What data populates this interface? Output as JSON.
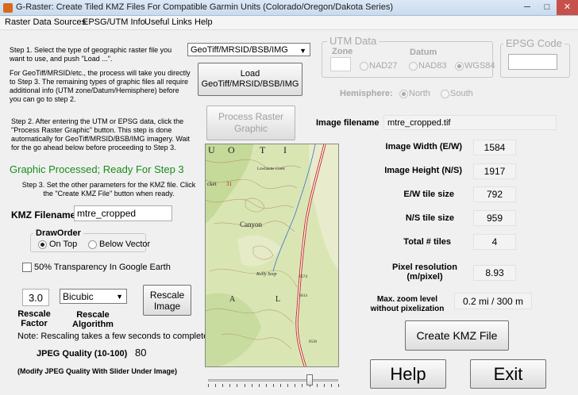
{
  "window": {
    "title": "G-Raster: Create Tiled KMZ Files For Compatible Garmin Units (Colorado/Oregon/Dakota Series)",
    "min": "─",
    "max": "□",
    "close": "✕"
  },
  "menu": {
    "items": [
      "Raster Data Sources",
      "EPSG/UTM Info",
      "Useful Links",
      "Help"
    ]
  },
  "step1": {
    "text": "Step 1. Select the type of geographic raster file you want to use, and push \"Load ...\".",
    "info": "For GeoTiff/MRSID/etc., the process will take you directly to Step 3. The remaining types of graphic files all require additional info (UTM zone/Datum/Hemisphere) before you can go to step 2.",
    "file_type": "GeoTiff/MRSID/BSB/IMG",
    "load_label": "Load GeoTiff/MRSID/BSB/IMG"
  },
  "utm": {
    "title": "UTM Data",
    "zone_label": "Zone",
    "datum_label": "Datum",
    "datums": [
      "NAD27",
      "NAD83",
      "WGS84"
    ],
    "hemisphere_label": "Hemisphere:",
    "north": "North",
    "south": "South"
  },
  "epsg": {
    "title": "EPSG Code"
  },
  "step2": {
    "text": "Step 2. After entering the UTM or EPSG data, click the \"Process Raster Graphic\" button.  This step is done automatically for GeoTiff/MRSID/BSB/IMG imagery. Wait for the go ahead below before proceeding to Step 3.",
    "process_label": "Process Raster Graphic"
  },
  "status": "Graphic Processed; Ready For Step 3",
  "step3": {
    "text": "Step 3. Set the other parameters for the KMZ file. Click the \"Create KMZ File\" button when ready."
  },
  "kmz": {
    "label": "KMZ Filename",
    "value": "mtre_cropped"
  },
  "draworder": {
    "title": "DrawOrder",
    "on_top": "On Top",
    "below": "Below Vector"
  },
  "transparency": {
    "label": "50% Transparency In Google Earth"
  },
  "rescale": {
    "factor": "3.0",
    "factor_label": "Rescale Factor",
    "algorithm": "Bicubic",
    "algorithm_label": "Rescale Algorithm",
    "button": "Rescale Image",
    "note": "Note: Rescaling takes a few seconds to complete"
  },
  "jpeg": {
    "label": "JPEG Quality (10-100)",
    "value": "80",
    "hint": "(Modify JPEG Quality With Slider Under Image)",
    "quality": 80
  },
  "map": {
    "grid_letters": [
      "U",
      "O",
      "T",
      "I"
    ],
    "labels": [
      "Lowlander Creek",
      "Canyon",
      "Kelly Seep",
      "A",
      "L",
      "31",
      "cket",
      "6614",
      "6574",
      "6530"
    ]
  },
  "info": {
    "filename_label": "Image filename",
    "filename": "mtre_cropped.tif",
    "rows": [
      {
        "label": "Image Width (E/W)",
        "value": "1584"
      },
      {
        "label": "Image Height (N/S)",
        "value": "1917"
      },
      {
        "label": "E/W tile size",
        "value": "792"
      },
      {
        "label": "N/S tile size",
        "value": "959"
      },
      {
        "label": "Total # tiles",
        "value": "4"
      },
      {
        "label": "Pixel resolution (m/pixel)",
        "value": "8.93"
      },
      {
        "label": "Max. zoom level without pixelization",
        "value": "0.2 mi / 300 m"
      }
    ]
  },
  "actions": {
    "create": "Create KMZ File",
    "help": "Help",
    "exit": "Exit"
  },
  "colors": {
    "accent_green": "#1a8c1a",
    "close_red": "#c7504a"
  }
}
